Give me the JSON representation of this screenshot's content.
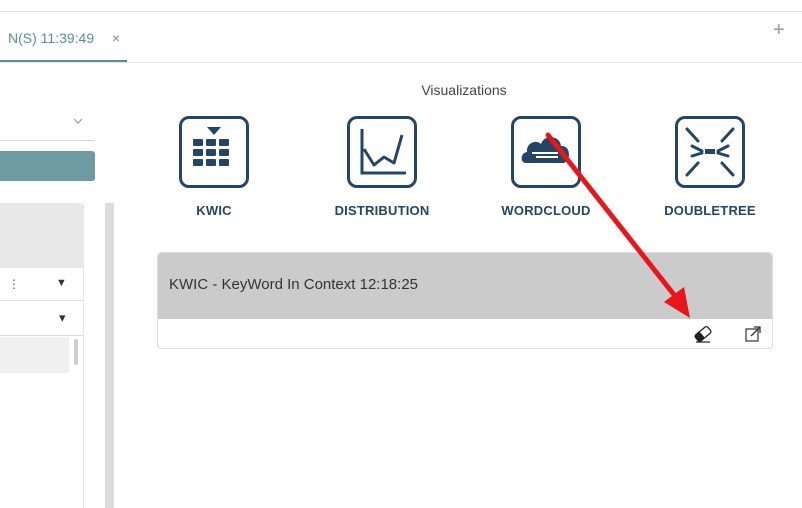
{
  "tabs": [
    {
      "label": "N(S) 11:39:49",
      "close": "×"
    }
  ],
  "add_tab_label": "+",
  "visualizations": {
    "title": "Visualizations",
    "items": [
      {
        "label": "KWIC",
        "icon": "kwic-grid-icon"
      },
      {
        "label": "DISTRIBUTION",
        "icon": "line-chart-icon"
      },
      {
        "label": "WORDCLOUD",
        "icon": "cloud-icon"
      },
      {
        "label": "DOUBLETREE",
        "icon": "doubletree-icon"
      }
    ]
  },
  "result_card": {
    "title": "KWIC - KeyWord In Context 12:18:25",
    "actions": [
      "eraser-icon",
      "expand-icon"
    ]
  },
  "left_panel": {
    "dropdown_caret_1": "▼",
    "dropdown_caret_2": "▾",
    "dropdown_tick": "⋮"
  },
  "colors": {
    "accent": "#5d8e93",
    "icon_navy": "#244563",
    "arrow_red": "#e8161a",
    "card_header": "#cbcbcb"
  }
}
